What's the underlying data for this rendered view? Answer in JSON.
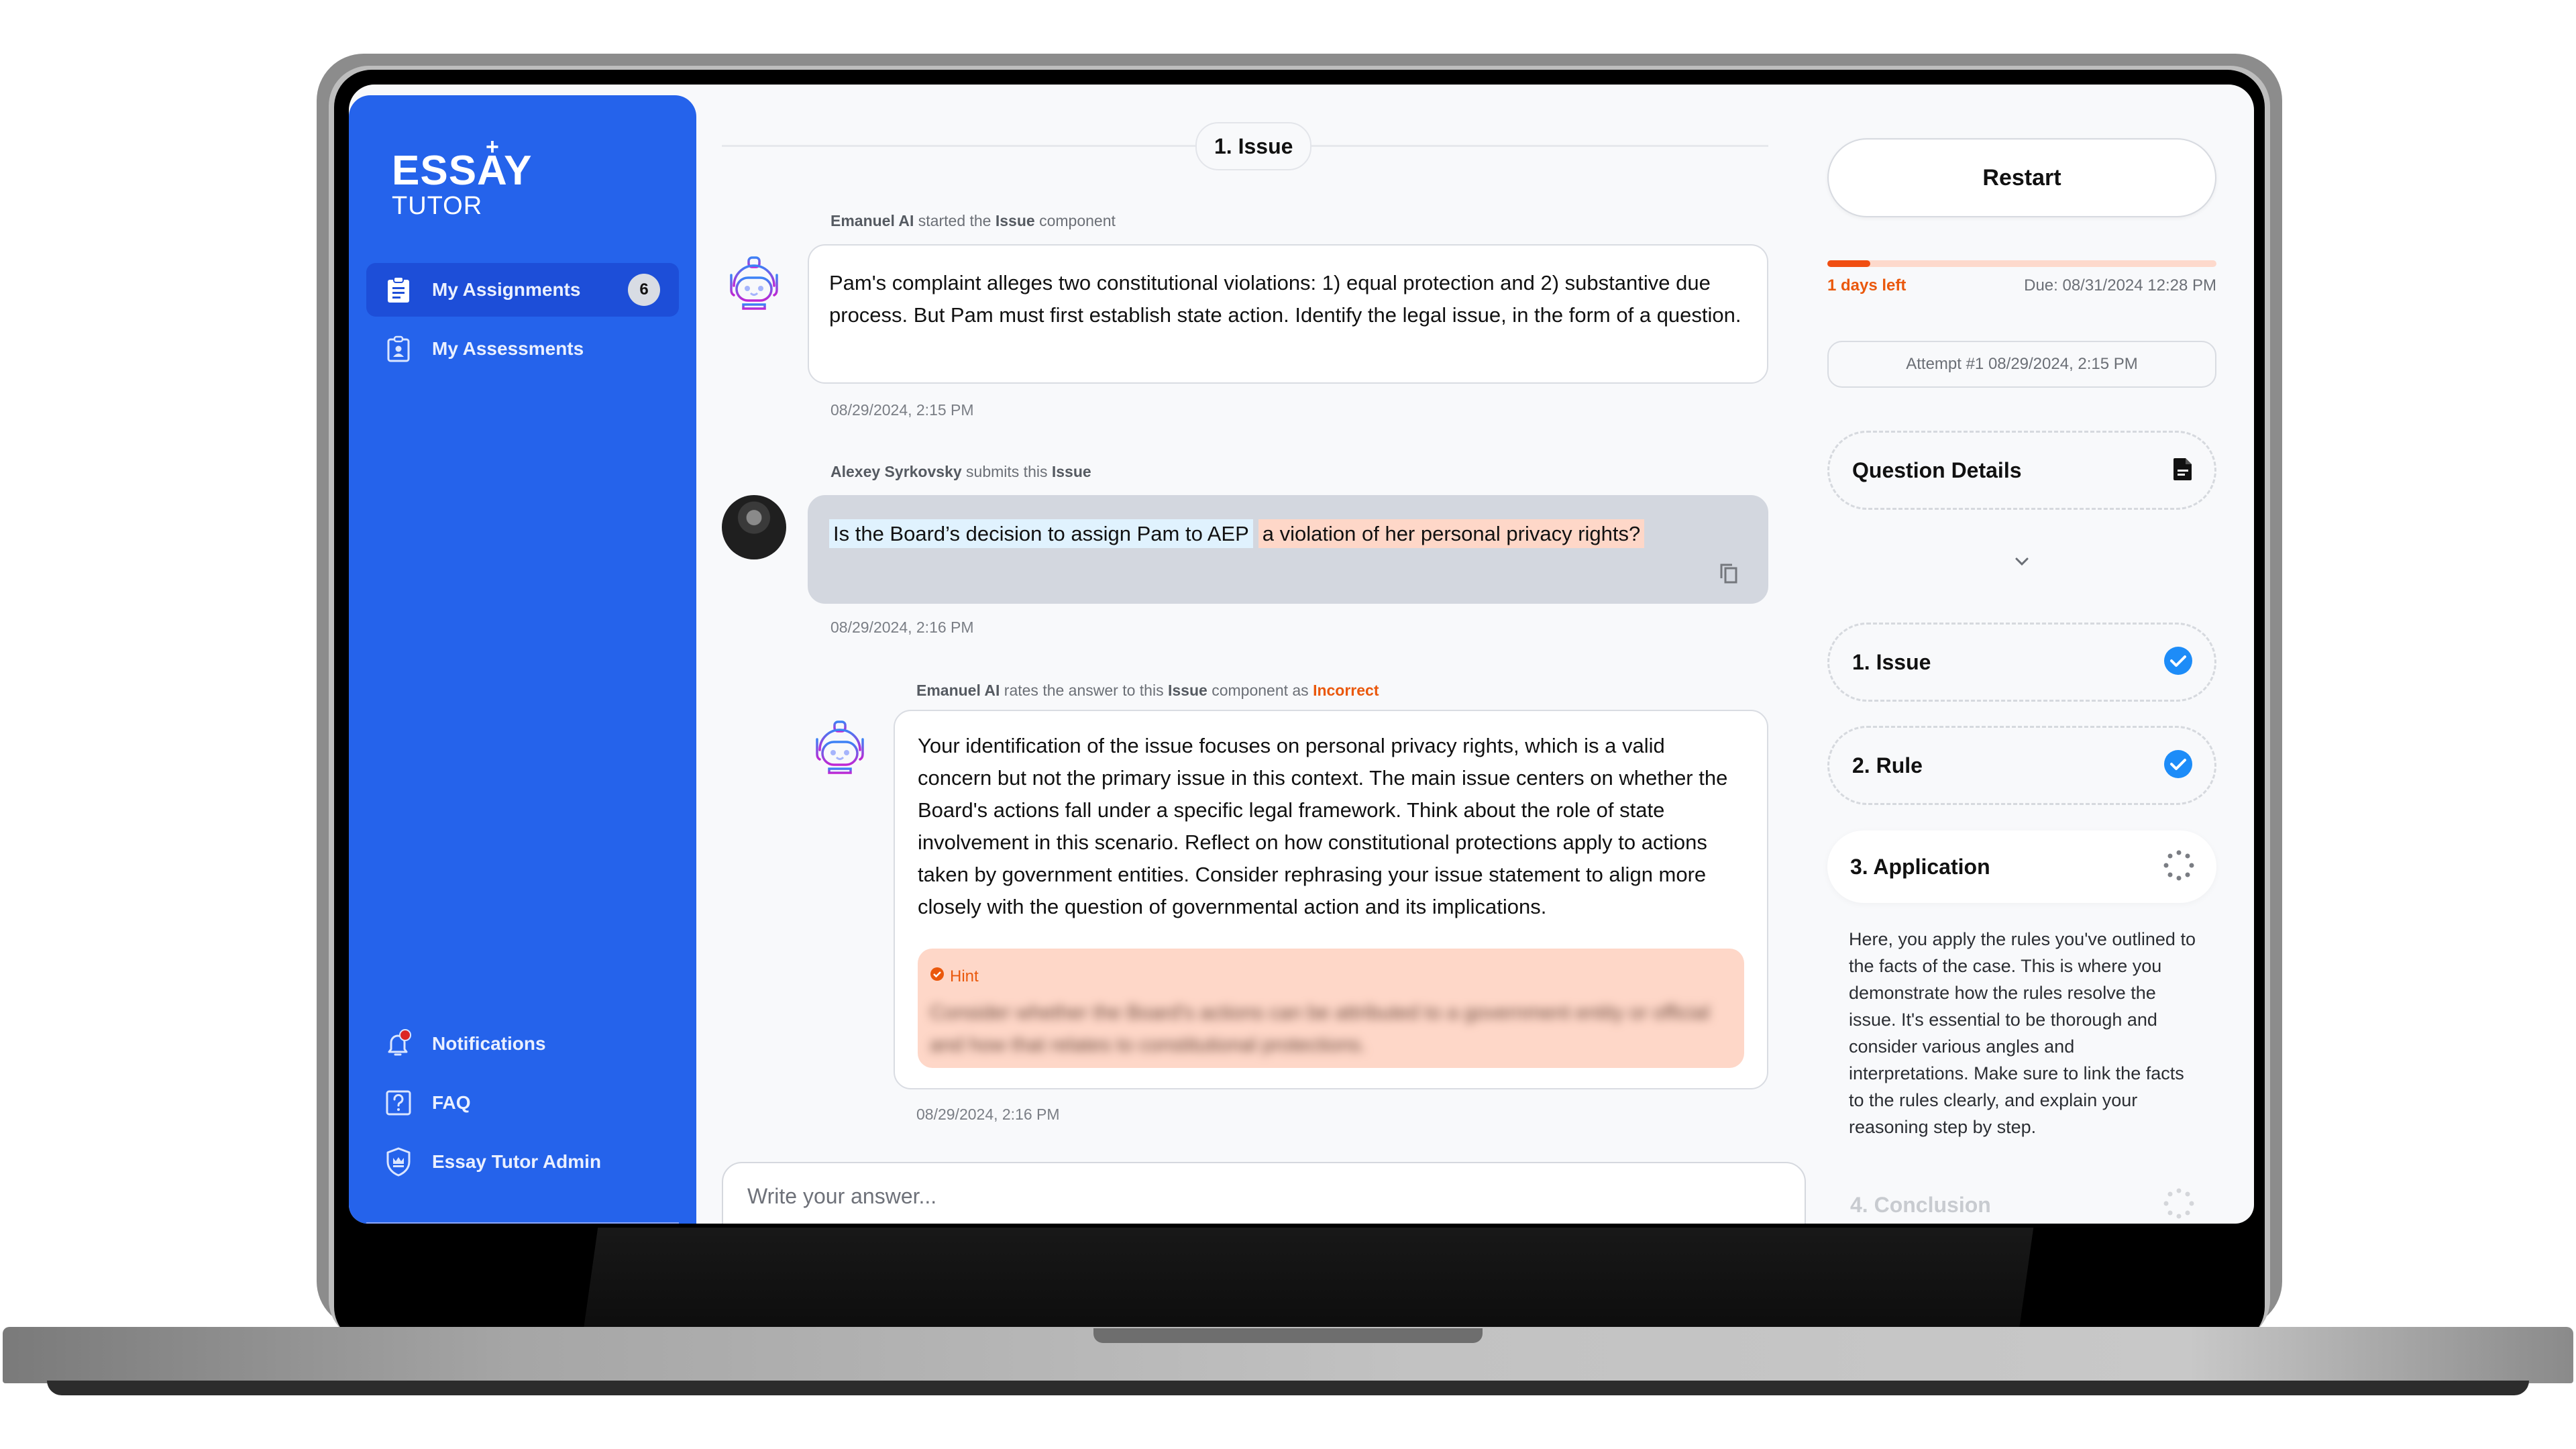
{
  "app": {
    "logo_top": "ESSAY",
    "logo_plus": "+",
    "logo_bottom": "TUTOR"
  },
  "sidebar": {
    "items": [
      {
        "label": "My Assignments",
        "icon": "clipboard-list-icon",
        "badge": "6",
        "active": true
      },
      {
        "label": "My Assessments",
        "icon": "clipboard-user-icon",
        "active": false
      }
    ],
    "bottom_items": [
      {
        "label": "Notifications",
        "icon": "bell-icon",
        "has_dot": true
      },
      {
        "label": "FAQ",
        "icon": "question-square-icon"
      },
      {
        "label": "Essay Tutor Admin",
        "icon": "shield-crown-icon"
      }
    ]
  },
  "chat": {
    "section_title": "1. Issue",
    "messages": [
      {
        "meta_actor": "Emanuel AI",
        "meta_text": " started the ",
        "meta_component": "Issue",
        "meta_suffix": " component",
        "text": "Pam's complaint alleges two constitutional violations: 1) equal protection and 2) substantive due process. But Pam must first establish state action. Identify the legal issue, in the form of a question.",
        "timestamp": "08/29/2024, 2:15 PM",
        "avatar": "robot-icon"
      },
      {
        "meta_actor": "Alexey Syrkovsky",
        "meta_text": " submits this ",
        "meta_component": "Issue",
        "segments": [
          {
            "text": "Is the Board’s decision to assign Pam to AEP",
            "highlight": "blue"
          },
          {
            "text": "a violation of her personal privacy rights?",
            "highlight": "orange"
          }
        ],
        "timestamp": "08/29/2024, 2:16 PM",
        "avatar": "user-photo",
        "copy_icon": "copy-icon"
      },
      {
        "meta_actor": "Emanuel AI",
        "meta_text": " rates the answer to this ",
        "meta_component": "Issue",
        "meta_suffix": " component as ",
        "rating": "Incorrect",
        "text": "Your identification of the issue focuses on personal privacy rights, which is a valid concern but not the primary issue in this context. The main issue centers on whether the Board's actions fall under a specific legal framework. Think about the role of state involvement in this scenario. Reflect on how constitutional protections apply to actions taken by government entities. Consider rephrasing your issue statement to align more closely with the question of governmental action and its implications.",
        "hint_label": "Hint",
        "hint_text": "Consider whether the Board's actions can be attributed to a government entity or official and how that relates to constitutional protections.",
        "timestamp": "08/29/2024, 2:16 PM",
        "avatar": "robot-icon"
      }
    ],
    "answer_placeholder": "Write your answer..."
  },
  "right_panel": {
    "restart_label": "Restart",
    "deadline_progress": 0.11,
    "days_left": "1 days left",
    "due": "Due: 08/31/2024 12:28 PM",
    "attempt": "Attempt #1 08/29/2024, 2:15 PM",
    "question_details": "Question Details",
    "steps": [
      {
        "label": "1.  Issue",
        "status": "complete"
      },
      {
        "label": "2.  Rule",
        "status": "complete"
      },
      {
        "label": "3.  Application",
        "status": "in-progress"
      },
      {
        "label": "4.  Conclusion",
        "status": "pending"
      }
    ],
    "current_step_description": "Here, you apply the rules you've outlined to the facts of the case. This is where you demonstrate how the rules resolve the issue. It's essential to be thorough and consider various angles and interpretations. Make sure to link the facts to the rules clearly, and explain your reasoning step by step."
  },
  "colors": {
    "brand": "#2563eb",
    "brand_active": "#1d4ed8",
    "accent_orange": "#ea580c",
    "check_blue": "#1d8cf8",
    "highlight_blue": "#e0f2fe",
    "highlight_orange": "#fed7c8"
  }
}
